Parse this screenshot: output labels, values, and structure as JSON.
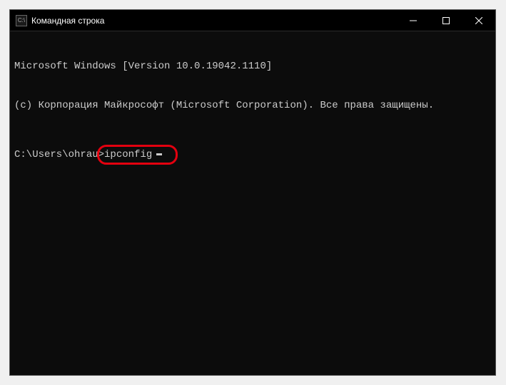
{
  "titlebar": {
    "icon_label": "C:\\",
    "title": "Командная строка"
  },
  "terminal": {
    "line1": "Microsoft Windows [Version 10.0.19042.1110]",
    "line2": "(c) Корпорация Майкрософт (Microsoft Corporation). Все права защищены.",
    "prompt": "C:\\Users\\ohrau>",
    "command": "ipconfig"
  }
}
